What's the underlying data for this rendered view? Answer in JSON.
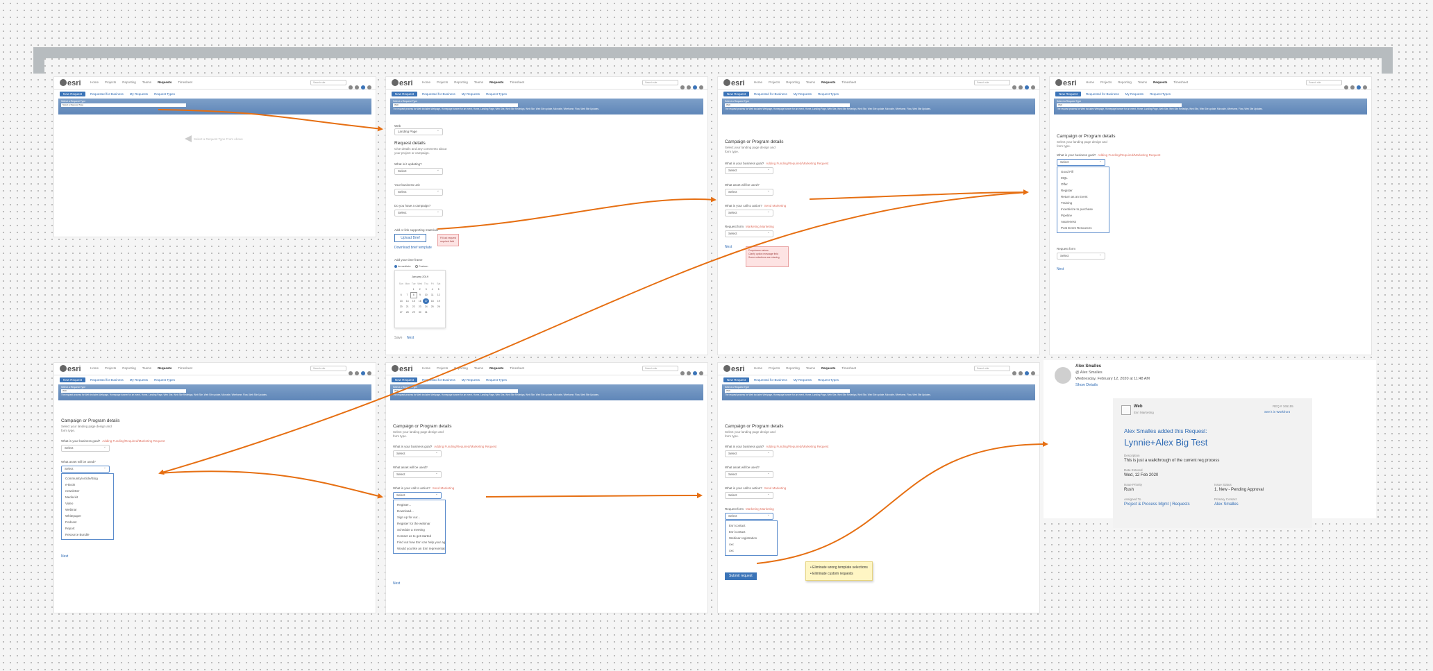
{
  "colors": {
    "accent": "#3b74b8",
    "arrow": "#e66f12",
    "board": "#b7bcbf",
    "band": "#6a8fc0"
  },
  "app": {
    "logo": "esri",
    "nav": [
      "Home",
      "Projects",
      "Reporting",
      "Teams",
      "Requests",
      "Timesheet"
    ],
    "active_nav": "Requests",
    "search_placeholder": "Search site",
    "subnav": {
      "new_request": "New Request",
      "items": [
        "Requested for Business",
        "My Requests",
        "Request Types"
      ]
    },
    "band_label": "Select a Request Type",
    "band_value": "Web",
    "band_desc": "The request process for Web includes Webpage, Homepage banner for an event, Home, Landing Page, Web Site, Web Site Redesign, Web Site, Web Site update, Microsite, Wireframe, Flow, Web Site Updates."
  },
  "screen1": {
    "band_select": "Select a Request Type",
    "empty_hint": "Select a Request Type From Above"
  },
  "screen2": {
    "type_label": "Web",
    "type_value": "Landing Page",
    "title": "Request details",
    "subtitle": "Give details and any comments about your project or campaign.",
    "q1": "What is it updating?",
    "q2": "Your business unit",
    "q3": "Do you have a campaign?",
    "select": "Select",
    "attach_label": "Add or link supporting materials",
    "upload": "Upload Brief",
    "download": "Download brief template",
    "redbox": [
      "Fill out request",
      "required field"
    ],
    "date_label": "Add your time frame",
    "radios": [
      "Immediate",
      "Custom"
    ],
    "month": "January 2019",
    "weekdays": [
      "Sun",
      "Mon",
      "Tue",
      "Wed",
      "Thu",
      "Fri",
      "Sat"
    ],
    "days": [
      [
        "",
        "",
        "1",
        "2",
        "3",
        "4",
        "5"
      ],
      [
        "6",
        "7",
        "8",
        "9",
        "10",
        "11",
        "12"
      ],
      [
        "13",
        "14",
        "15",
        "16",
        "17",
        "18",
        "19"
      ],
      [
        "20",
        "21",
        "22",
        "23",
        "24",
        "25",
        "26"
      ],
      [
        "27",
        "28",
        "29",
        "30",
        "31",
        "",
        ""
      ]
    ],
    "save": "Save",
    "next": "Next"
  },
  "campaign": {
    "title": "Campaign or Program details",
    "subtitle": "Select your landing page design and form type.",
    "q_goal": "What is your business goal?",
    "goal_note": "Adding Funding/Required/Marketing Request",
    "q_asset": "What asset will be used?",
    "q_cta": "What is your call to action?",
    "cta_note": "Send Marketing",
    "q_form": "Request form",
    "form_note": "Marketing Marketing",
    "select": "Select",
    "next": "Next",
    "submit": "Submit request"
  },
  "screen3": {
    "redbox": [
      "Dropdowns values",
      "Clarify option message field",
      "Some selections are missing"
    ]
  },
  "screen4": {
    "goal_options": [
      "Good Fill",
      "MQL",
      "Offer",
      "Register",
      "Return as an Event",
      "Training",
      "Incentivize to purchase",
      "Pipeline",
      "Awareness",
      "Post Event Resources"
    ]
  },
  "screen5": {
    "asset_options": [
      "Community/Article/Blog",
      "e-Book",
      "newsletter",
      "Media kit",
      "Video",
      "Webinar",
      "Whitepaper",
      "Podcast",
      "Report",
      "Resource Bundle"
    ]
  },
  "screen6": {
    "cta_options": [
      "Register...",
      "Download...",
      "Sign up for our...",
      "Register for the webinar",
      "Schedule a meeting",
      "Contact us to get started",
      "Find out how Esri can help your agency/organization",
      "Would you like an Esri representative to contact you?"
    ]
  },
  "screen7": {
    "form_options": [
      "Esri contact",
      "Esri contact",
      "Webinar registration",
      "xxx",
      "xxx"
    ],
    "sticky": [
      "Eliminate wrong template selections",
      "Eliminate custom requests"
    ]
  },
  "email": {
    "from": "Alex Smalles",
    "handle": "@ Alex Smalles",
    "date": "Wednesday, February 12, 2020 at 11:48 AM",
    "show": "Show Details",
    "app": "Web",
    "app_sub": "Esri Marketing",
    "req_id": "REQ # 165155",
    "view_link": "See it in Workfront",
    "added": "Alex Smalles added this Request:",
    "title": "Lynnie+Alex Big Test",
    "desc_cap": "Description",
    "desc": "This is just a walkthrough of the current req process",
    "entered_cap": "Date Entered",
    "entered": "Wed, 12 Feb 2020",
    "priority_cap": "Issue Priority",
    "priority": "Rush",
    "status_cap": "Issue Status",
    "status": "1. New - Pending Approval",
    "assigned_cap": "Assigned To",
    "assigned": "Project & Process Mgmt | Requests",
    "contact_cap": "Primary Contact",
    "contact": "Alex Smalles"
  }
}
